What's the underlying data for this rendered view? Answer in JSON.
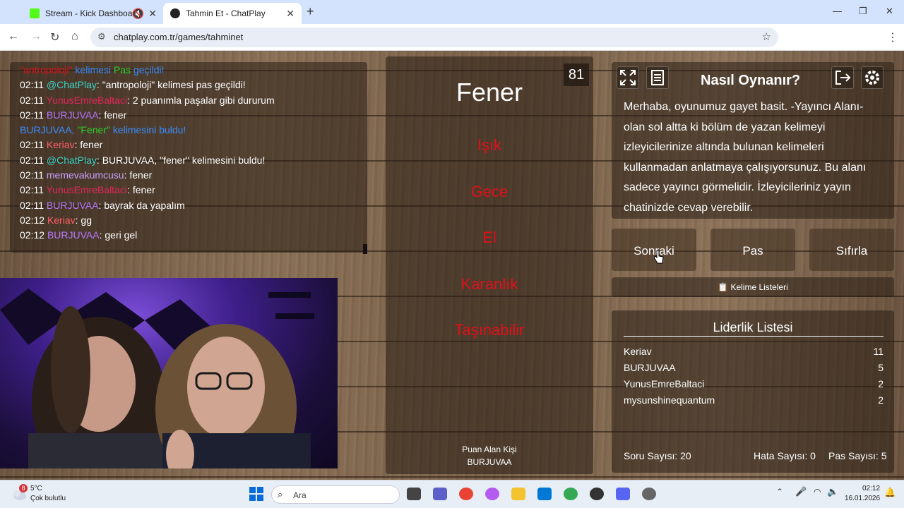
{
  "browser": {
    "tabs": [
      {
        "title": "Stream - Kick Dashboard"
      },
      {
        "title": "Tahmin Et - ChatPlay"
      }
    ],
    "url": "chatplay.com.tr/games/tahminet"
  },
  "chat": {
    "lines": [
      [
        {
          "t": "\"antropoloji\"",
          "c": "#e0101a"
        },
        {
          "t": " kelimesi ",
          "c": "#3a8bff"
        },
        {
          "t": "Pas",
          "c": "#2bd12b"
        },
        {
          "t": " geçildi!",
          "c": "#3a8bff"
        }
      ],
      [
        {
          "t": "02:11 ",
          "c": "#ffffff"
        },
        {
          "t": "@ChatPlay",
          "c": "#39d4c8"
        },
        {
          "t": ": \"antropoloji\" kelimesi pas geçildi!",
          "c": "#ffffff"
        }
      ],
      [
        {
          "t": "02:11 ",
          "c": "#ffffff"
        },
        {
          "t": "YunusEmreBaltaci",
          "c": "#e3265a"
        },
        {
          "t": ": 2 puanımla paşalar gibi dururum",
          "c": "#ffffff"
        }
      ],
      [
        {
          "t": "02:11 ",
          "c": "#ffffff"
        },
        {
          "t": "BURJUVAA",
          "c": "#b678ff"
        },
        {
          "t": ": fener",
          "c": "#ffffff"
        }
      ],
      [
        {
          "t": "BURJUVAA, ",
          "c": "#3a8bff"
        },
        {
          "t": "\"Fener\"",
          "c": "#2bd12b"
        },
        {
          "t": " kelimesini buldu!",
          "c": "#3a8bff"
        }
      ],
      [
        {
          "t": "02:11 ",
          "c": "#ffffff"
        },
        {
          "t": "Keriav",
          "c": "#ff5e6a"
        },
        {
          "t": ": fener",
          "c": "#ffffff"
        }
      ],
      [
        {
          "t": "02:11 ",
          "c": "#ffffff"
        },
        {
          "t": "@ChatPlay",
          "c": "#39d4c8"
        },
        {
          "t": ": BURJUVAA, \"fener\" kelimesini buldu!",
          "c": "#ffffff"
        }
      ],
      [
        {
          "t": "02:11 ",
          "c": "#ffffff"
        },
        {
          "t": "memevakumcusu",
          "c": "#c9a0ff"
        },
        {
          "t": ": fener",
          "c": "#ffffff"
        }
      ],
      [
        {
          "t": "02:11 ",
          "c": "#ffffff"
        },
        {
          "t": "YunusEmreBaltaci",
          "c": "#e3265a"
        },
        {
          "t": ": fener",
          "c": "#ffffff"
        }
      ],
      [
        {
          "t": "02:11 ",
          "c": "#ffffff"
        },
        {
          "t": "BURJUVAA",
          "c": "#b678ff"
        },
        {
          "t": ": bayrak da yapalım",
          "c": "#ffffff"
        }
      ],
      [
        {
          "t": "02:12 ",
          "c": "#ffffff"
        },
        {
          "t": "Keriav",
          "c": "#ff5e6a"
        },
        {
          "t": ": gg",
          "c": "#ffffff"
        }
      ],
      [
        {
          "t": "02:12 ",
          "c": "#ffffff"
        },
        {
          "t": "BURJUVAA",
          "c": "#b678ff"
        },
        {
          "t": ": geri gel",
          "c": "#ffffff"
        }
      ]
    ]
  },
  "game": {
    "timer": "81",
    "word": "Fener",
    "forbidden": [
      "Işık",
      "Gece",
      "El",
      "Karanlık",
      "Taşınabilir"
    ],
    "scorer_label": "Puan Alan Kişi",
    "scorer_name": "BURJUVAA"
  },
  "rules": {
    "title": "Nasıl Oynanır?",
    "text": "Merhaba, oyunumuz gayet basit. -Yayıncı Alanı- olan sol altta ki bölüm de yazan kelimeyi izleyicilerinize altında bulunan kelimeleri kullanmadan anlatmaya çalışıyorsunuz. Bu alanı sadece yayıncı görmelidir. İzleyicileriniz yayın chatinizde cevap verebilir."
  },
  "buttons": {
    "next": "Sonraki",
    "pass": "Pas",
    "reset": "Sıfırla"
  },
  "word_lists": "Kelime Listeleri",
  "leaderboard": {
    "title": "Liderlik Listesi",
    "rows": [
      {
        "name": "Keriav",
        "score": "11"
      },
      {
        "name": "BURJUVAA",
        "score": "5"
      },
      {
        "name": "YunusEmreBaltaci",
        "score": "2"
      },
      {
        "name": "mysunshinequantum",
        "score": "2"
      }
    ],
    "question_count": "Soru Sayısı: 20",
    "error_count": "Hata Sayısı: 0",
    "pass_count": "Pas Sayısı: 5"
  },
  "taskbar": {
    "weather_temp": "5°C",
    "weather_desc": "Çok bulutlu",
    "weather_badge": "8",
    "search_placeholder": "Ara",
    "time": "02:12",
    "date": "16.01.2026"
  }
}
